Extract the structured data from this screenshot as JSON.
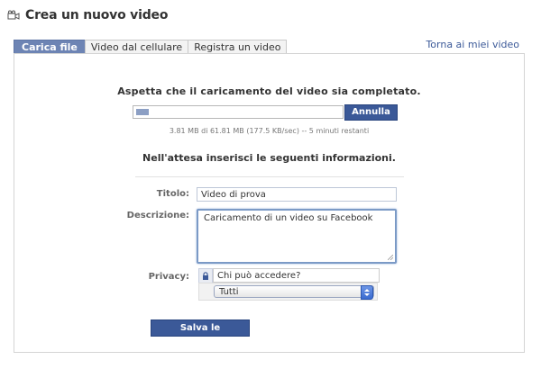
{
  "header": {
    "title": "Crea un nuovo video",
    "icon": "video-camera-icon"
  },
  "tabs": [
    {
      "label": "Carica file",
      "active": true
    },
    {
      "label": "Video dal cellulare",
      "active": false
    },
    {
      "label": "Registra un video",
      "active": false
    }
  ],
  "back_link": "Torna ai miei video",
  "upload": {
    "wait_message": "Aspetta che il caricamento del video sia completato.",
    "progress_fraction": 0.06,
    "cancel_label": "Annulla",
    "progress_text": "3.81 MB di 61.81 MB (177.5 KB/sec) -- 5 minuti restanti"
  },
  "form": {
    "heading": "Nell'attesa inserisci le seguenti informazioni.",
    "title_label": "Titolo:",
    "title_value": "Video di prova",
    "description_label": "Descrizione:",
    "description_value": "Caricamento di un video su Facebook",
    "privacy_label": "Privacy:",
    "privacy_question": "Chi può accedere?",
    "privacy_selected": "Tutti",
    "save_label": "Salva le informazioni"
  },
  "colors": {
    "accent": "#3b5998",
    "tab_active": "#6d84b4",
    "progress_fill": "#8c9fc4"
  }
}
